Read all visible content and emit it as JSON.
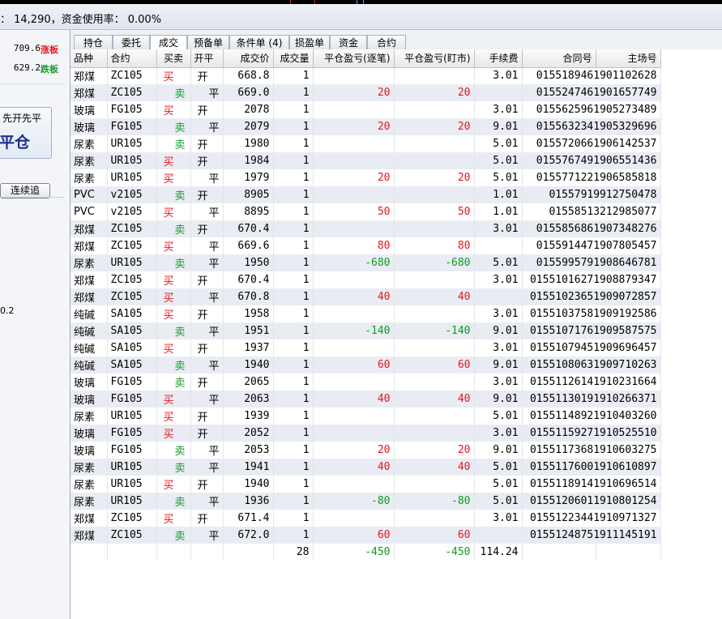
{
  "status": {
    "text": "： 14,290，资金使用率： 0.00%"
  },
  "left_panel": {
    "limit_up": {
      "price": "709.6",
      "label": "涨板"
    },
    "limit_down": {
      "price": "629.2",
      "label": "跌板"
    },
    "mode_small": "先开先平",
    "mode_big": "平仓",
    "continue_btn": "连续追",
    "side_value": "0.2"
  },
  "colors": {
    "buy": "#e8141b",
    "sell": "#169b2b",
    "limit_up": "#e8141b",
    "limit_down": "#169b2b"
  },
  "tabs": [
    {
      "label": "持仓"
    },
    {
      "label": "委托"
    },
    {
      "label": "成交"
    },
    {
      "label": "预备单"
    },
    {
      "label": "条件单 (4)"
    },
    {
      "label": "损盈单"
    },
    {
      "label": "资金"
    },
    {
      "label": "合约"
    }
  ],
  "active_tab": "成交",
  "table": {
    "columns": [
      "品种",
      "合约",
      "买卖",
      "开平",
      "成交价",
      "成交量",
      "平仓盈亏(逐笔)",
      "平仓盈亏(盯市)",
      "手续费",
      "合同号",
      "主场号"
    ],
    "rows": [
      [
        "郑煤",
        "ZC105",
        "买",
        "开",
        "668.8",
        "1",
        "",
        "",
        "3.01",
        "01551894619011",
        "02628"
      ],
      [
        "郑煤",
        "ZC105",
        "卖",
        "平",
        "669.0",
        "1",
        "20",
        "20",
        "",
        "01552474619016",
        "57749"
      ],
      [
        "玻璃",
        "FG105",
        "买",
        "开",
        "2078",
        "1",
        "",
        "",
        "3.01",
        "01556259619052",
        "73489"
      ],
      [
        "玻璃",
        "FG105",
        "卖",
        "平",
        "2079",
        "1",
        "20",
        "20",
        "9.01",
        "01556323419053",
        "29696"
      ],
      [
        "尿素",
        "UR105",
        "卖",
        "开",
        "1980",
        "1",
        "",
        "",
        "5.01",
        "01557206619061",
        "42537"
      ],
      [
        "尿素",
        "UR105",
        "买",
        "开",
        "1984",
        "1",
        "",
        "",
        "5.01",
        "01557674919065",
        "51436"
      ],
      [
        "尿素",
        "UR105",
        "买",
        "平",
        "1979",
        "1",
        "20",
        "20",
        "5.01",
        "01557712219065",
        "85818"
      ],
      [
        "PVC",
        "v2105",
        "卖",
        "开",
        "8905",
        "1",
        "",
        "",
        "1.01",
        "015579199",
        "12750478"
      ],
      [
        "PVC",
        "v2105",
        "买",
        "平",
        "8895",
        "1",
        "50",
        "50",
        "1.01",
        "015585132",
        "12985077"
      ],
      [
        "郑煤",
        "ZC105",
        "卖",
        "开",
        "670.4",
        "1",
        "",
        "",
        "3.01",
        "01558568619073",
        "48276"
      ],
      [
        "郑煤",
        "ZC105",
        "买",
        "平",
        "669.6",
        "1",
        "80",
        "80",
        "",
        "01559144719078",
        "05457"
      ],
      [
        "尿素",
        "UR105",
        "卖",
        "平",
        "1950",
        "1",
        "-680",
        "-680",
        "5.01",
        "01559957919086",
        "46781"
      ],
      [
        "郑煤",
        "ZC105",
        "买",
        "开",
        "670.4",
        "1",
        "",
        "",
        "3.01",
        "01551016271908",
        "879347"
      ],
      [
        "郑煤",
        "ZC105",
        "买",
        "平",
        "670.8",
        "1",
        "40",
        "40",
        "",
        "01551023651909",
        "072857"
      ],
      [
        "纯碱",
        "SA105",
        "买",
        "开",
        "1958",
        "1",
        "",
        "",
        "3.01",
        "01551037581909",
        "192586"
      ],
      [
        "纯碱",
        "SA105",
        "卖",
        "平",
        "1951",
        "1",
        "-140",
        "-140",
        "9.01",
        "01551071761909",
        "587575"
      ],
      [
        "纯碱",
        "SA105",
        "买",
        "开",
        "1937",
        "1",
        "",
        "",
        "3.01",
        "01551079451909",
        "696457"
      ],
      [
        "纯碱",
        "SA105",
        "卖",
        "平",
        "1940",
        "1",
        "60",
        "60",
        "9.01",
        "01551080631909",
        "710263"
      ],
      [
        "玻璃",
        "FG105",
        "卖",
        "开",
        "2065",
        "1",
        "",
        "",
        "3.01",
        "01551126141910",
        "231664"
      ],
      [
        "玻璃",
        "FG105",
        "买",
        "平",
        "2063",
        "1",
        "40",
        "40",
        "9.01",
        "01551130191910",
        "266371"
      ],
      [
        "尿素",
        "UR105",
        "买",
        "开",
        "1939",
        "1",
        "",
        "",
        "5.01",
        "01551148921910",
        "403260"
      ],
      [
        "玻璃",
        "FG105",
        "买",
        "开",
        "2052",
        "1",
        "",
        "",
        "3.01",
        "01551159271910",
        "525510"
      ],
      [
        "玻璃",
        "FG105",
        "卖",
        "平",
        "2053",
        "1",
        "20",
        "20",
        "9.01",
        "01551173681910",
        "603275"
      ],
      [
        "尿素",
        "UR105",
        "卖",
        "平",
        "1941",
        "1",
        "40",
        "40",
        "5.01",
        "01551176001910",
        "610897"
      ],
      [
        "尿素",
        "UR105",
        "买",
        "开",
        "1940",
        "1",
        "",
        "",
        "5.01",
        "01551189141910",
        "696514"
      ],
      [
        "尿素",
        "UR105",
        "卖",
        "平",
        "1936",
        "1",
        "-80",
        "-80",
        "5.01",
        "01551206011910",
        "801254"
      ],
      [
        "郑煤",
        "ZC105",
        "买",
        "开",
        "671.4",
        "1",
        "",
        "",
        "3.01",
        "01551223441910",
        "971327"
      ],
      [
        "郑煤",
        "ZC105",
        "卖",
        "平",
        "672.0",
        "1",
        "60",
        "60",
        "",
        "01551248751911",
        "145191"
      ]
    ],
    "totals": {
      "volume": "28",
      "pnl_each": "-450",
      "pnl_mtm": "-450",
      "fee": "114.24"
    }
  }
}
